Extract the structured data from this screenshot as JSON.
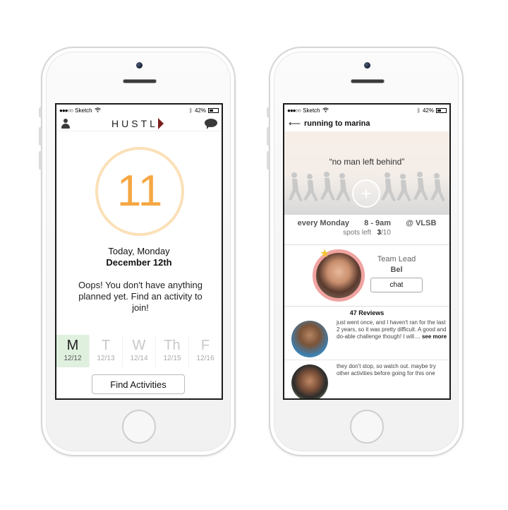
{
  "left_screen": {
    "status": {
      "carrier": "Sketch",
      "battery": "42%"
    },
    "header": {
      "logo": "HUSTL"
    },
    "today": {
      "day_number": "11",
      "line1": "Today, Monday",
      "line2": "December 12th",
      "message": "Oops! You don't have anything planned yet. Find an activity to join!"
    },
    "week": [
      {
        "letter": "M",
        "date": "12/12",
        "active": true
      },
      {
        "letter": "T",
        "date": "12/13",
        "active": false
      },
      {
        "letter": "W",
        "date": "12/14",
        "active": false
      },
      {
        "letter": "Th",
        "date": "12/15",
        "active": false
      },
      {
        "letter": "F",
        "date": "12/16",
        "active": false
      }
    ],
    "find_button": "Find Activities"
  },
  "right_screen": {
    "status": {
      "carrier": "Sketch",
      "battery": "42%"
    },
    "header": {
      "title": "running to marina"
    },
    "hero": {
      "quote": "“no man left behind”",
      "plus": "+"
    },
    "schedule": {
      "day": "every Monday",
      "time": "8 - 9am",
      "place": "@ VLSB",
      "spots_label": "spots left",
      "spots_taken": "3",
      "spots_total": "/10"
    },
    "lead": {
      "role": "Team Lead",
      "name": "Bel",
      "chat_label": "chat"
    },
    "reviews": {
      "title": "47 Reviews",
      "items": [
        {
          "text": "just went once, and I haven't ran for the last 2 years, so it was pretty difficult. A good and do-able challenge though! I will....",
          "more": "see more"
        },
        {
          "text": "they don't stop, so watch out. maybe try other activities before going for this one",
          "more": ""
        }
      ]
    }
  },
  "colors": {
    "accent_orange": "#f5a742",
    "ring": "#fbe0b8",
    "active_day": "#dff0df",
    "logo_mark": "#7b1f1f",
    "lead_ring": "#f0a3a1"
  }
}
